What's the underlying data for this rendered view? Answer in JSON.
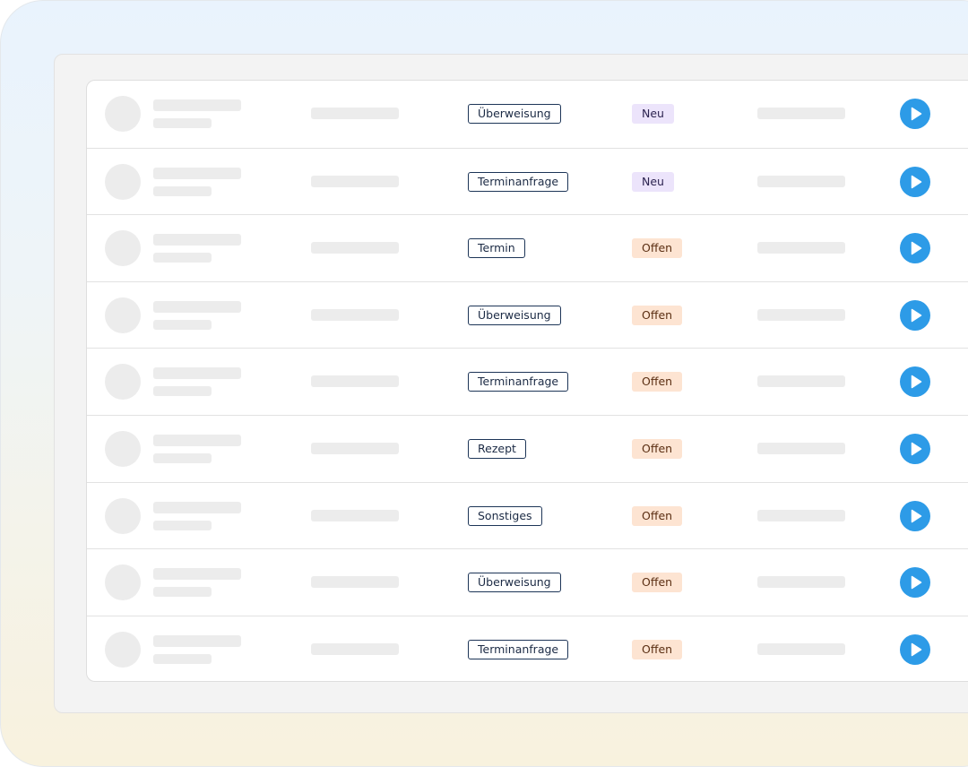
{
  "colors": {
    "accent": "#2d9be7",
    "status_neu_bg": "#ece4fb",
    "status_offen_bg": "#fde4d2",
    "tag_border": "#1d3557"
  },
  "rows": [
    {
      "type": "Überweisung",
      "status": "Neu",
      "status_kind": "neu",
      "action_icon": "play-icon"
    },
    {
      "type": "Terminanfrage",
      "status": "Neu",
      "status_kind": "neu",
      "action_icon": "play-icon"
    },
    {
      "type": "Termin",
      "status": "Offen",
      "status_kind": "offen",
      "action_icon": "play-icon"
    },
    {
      "type": "Überweisung",
      "status": "Offen",
      "status_kind": "offen",
      "action_icon": "play-icon"
    },
    {
      "type": "Terminanfrage",
      "status": "Offen",
      "status_kind": "offen",
      "action_icon": "play-icon"
    },
    {
      "type": "Rezept",
      "status": "Offen",
      "status_kind": "offen",
      "action_icon": "play-icon"
    },
    {
      "type": "Sonstiges",
      "status": "Offen",
      "status_kind": "offen",
      "action_icon": "play-icon"
    },
    {
      "type": "Überweisung",
      "status": "Offen",
      "status_kind": "offen",
      "action_icon": "play-icon"
    },
    {
      "type": "Terminanfrage",
      "status": "Offen",
      "status_kind": "offen",
      "action_icon": "play-icon"
    }
  ]
}
